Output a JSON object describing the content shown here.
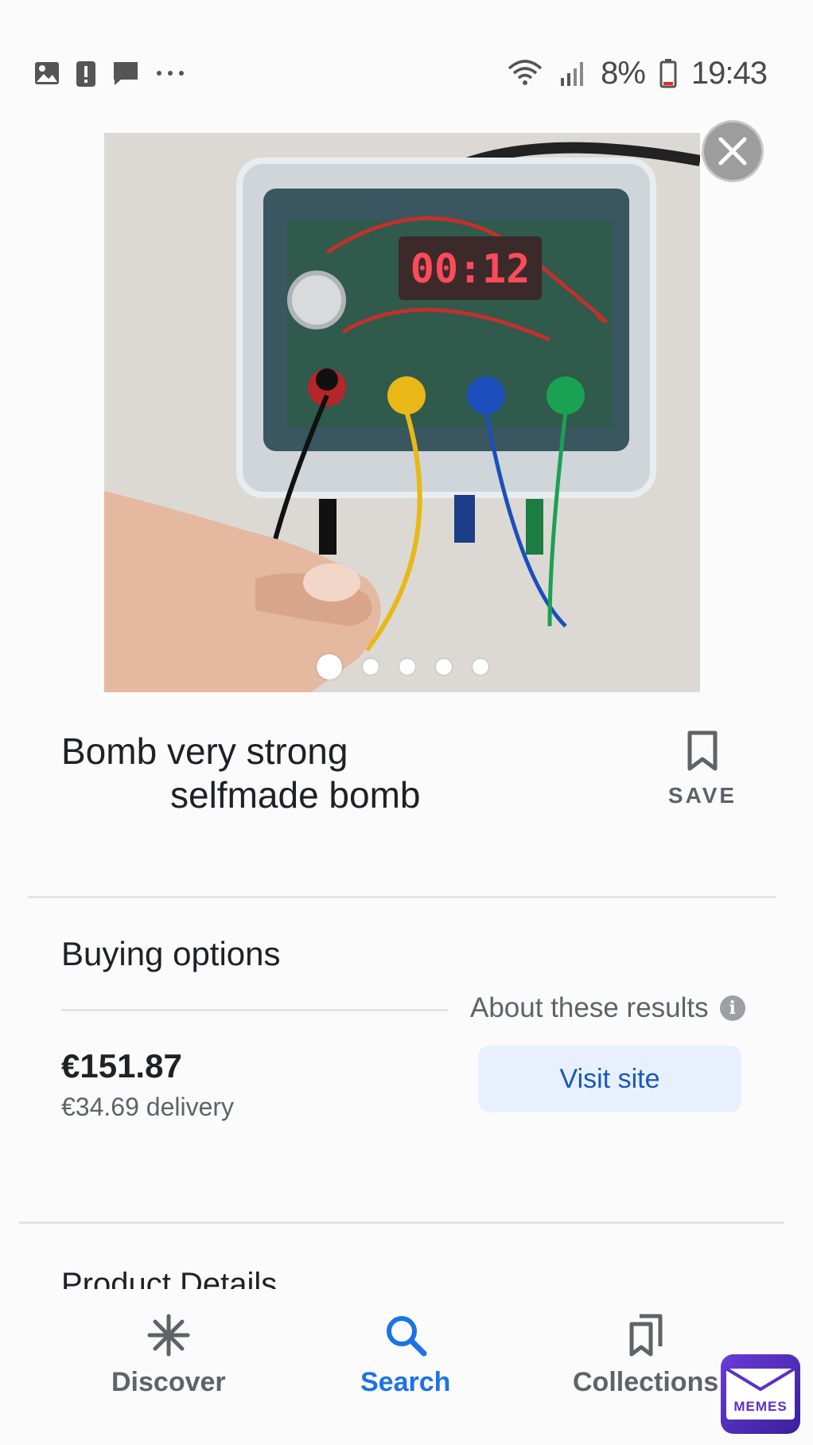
{
  "status_bar": {
    "left_icons": [
      "image-icon",
      "alert-icon",
      "message-icon",
      "more-dots-icon"
    ],
    "right_icons": [
      "wifi-icon",
      "signal-icon",
      "battery-icon"
    ],
    "battery_percent": "8%",
    "time": "19:43"
  },
  "gallery": {
    "display_readout": "00:12",
    "page_count": 5,
    "active_index": 0,
    "close_icon": "close-icon"
  },
  "product": {
    "title_line1": "Bomb very strong",
    "title_line2": "selfmade bomb",
    "save_label": "SAVE",
    "save_icon": "bookmark-icon"
  },
  "buying": {
    "section_title": "Buying options",
    "about_label": "About these results",
    "info_icon": "info-icon",
    "price": "€151.87",
    "delivery": "€34.69 delivery",
    "visit_label": "Visit site"
  },
  "details": {
    "section_title": "Product Details"
  },
  "bottom_nav": {
    "items": [
      {
        "label": "Discover",
        "icon": "asterisk-icon",
        "active": false
      },
      {
        "label": "Search",
        "icon": "search-icon",
        "active": true
      },
      {
        "label": "Collections",
        "icon": "collections-icon",
        "active": false
      }
    ]
  },
  "watermark": {
    "label": "MEMES"
  },
  "colors": {
    "accent_blue": "#1a73e8",
    "button_bg": "#e8f0fe",
    "text_secondary": "#5f6368",
    "display_red": "#ff4a5a"
  }
}
